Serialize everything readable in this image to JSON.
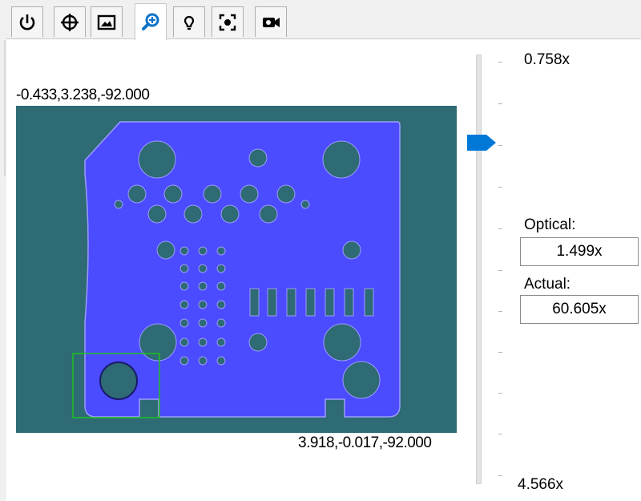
{
  "tabs": [
    {
      "name": "power-icon",
      "active": false
    },
    {
      "name": "crosshair-icon",
      "active": false
    },
    {
      "name": "image-icon",
      "active": false
    },
    {
      "name": "zoom-icon",
      "active": true
    },
    {
      "name": "lightbulb-icon",
      "active": false
    },
    {
      "name": "focus-icon",
      "active": false
    },
    {
      "name": "camera-icon",
      "active": false
    }
  ],
  "viewport": {
    "top_left_coord": "-0.433,3.238,-92.000",
    "bottom_right_coord": "3.918,-0.017,-92.000",
    "colors": {
      "background": "#2e6b75",
      "part_fill": "#4b4bff",
      "outline": "#9c9cff",
      "selection": "#1fc21f"
    }
  },
  "zoom": {
    "max_label": "0.758x",
    "min_label": "4.566x",
    "slider_level_fraction": 0.2,
    "accent": "#0078d7",
    "optical_label": "Optical:",
    "optical_value": "1.499x",
    "actual_label": "Actual:",
    "actual_value": "60.605x"
  }
}
